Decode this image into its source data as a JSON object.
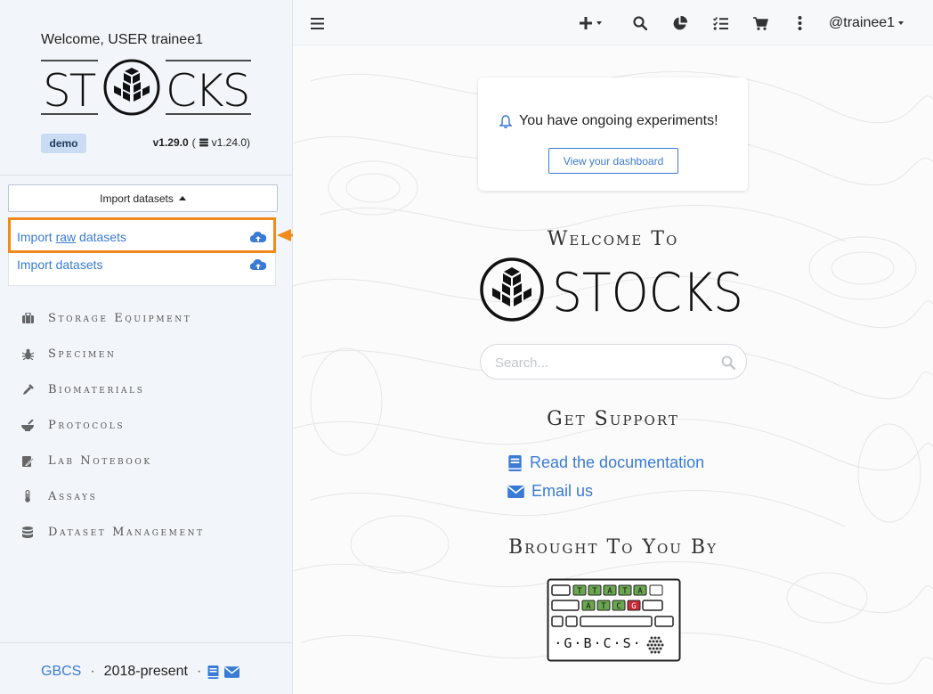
{
  "sidebar": {
    "welcome": "Welcome, USER trainee1",
    "badge": "demo",
    "version": "v1.29.0",
    "version_paren_open": "(",
    "db_version": "v1.24.0)",
    "import_toggle_label": "Import datasets",
    "dropdown": {
      "item1_prefix": "Import ",
      "item1_raw": "raw",
      "item1_suffix": " datasets",
      "item2": "Import datasets"
    },
    "nav": [
      {
        "label": "Storage Equipment",
        "icon": "suitcase-icon"
      },
      {
        "label": "Specimen",
        "icon": "bug-icon"
      },
      {
        "label": "Biomaterials",
        "icon": "dropper-icon"
      },
      {
        "label": "Protocols",
        "icon": "mortar-icon"
      },
      {
        "label": "Lab Notebook",
        "icon": "notebook-icon"
      },
      {
        "label": "Assays",
        "icon": "thermometer-icon"
      },
      {
        "label": "Dataset Management",
        "icon": "database-icon"
      }
    ],
    "footer": {
      "gbcs": "GBCS",
      "sep1": "·",
      "years": "2018-present",
      "sep2": "·"
    }
  },
  "topbar": {
    "user": "@trainee1",
    "icons": [
      "menu-icon",
      "plus-icon",
      "search-icon",
      "pie-chart-icon",
      "tasks-icon",
      "cart-icon",
      "kebab-icon"
    ]
  },
  "main": {
    "notice": "You have ongoing experiments!",
    "dashboard_button": "View your dashboard",
    "welcome_to": "Welcome To",
    "search_placeholder": "Search...",
    "get_support": "Get Support",
    "read_docs": "Read the documentation",
    "email_us": "Email us",
    "brought_by": "Brought To You By"
  },
  "logos": {
    "stocks_left": "ST",
    "stocks_right": "CKS",
    "stocks_big": "STOCKS",
    "gbcs_row1": [
      "T",
      "T",
      "A",
      "T",
      "A"
    ],
    "gbcs_row2": [
      "A",
      "T",
      "C",
      "G"
    ],
    "gbcs_text": "·G·B·C·S·"
  },
  "colors": {
    "accent": "#3a7bd5",
    "highlight": "#f08a1c",
    "badge_bg": "#c9dcf3",
    "gbcs_green": "#6aa84f",
    "gbcs_red": "#cc2936"
  }
}
